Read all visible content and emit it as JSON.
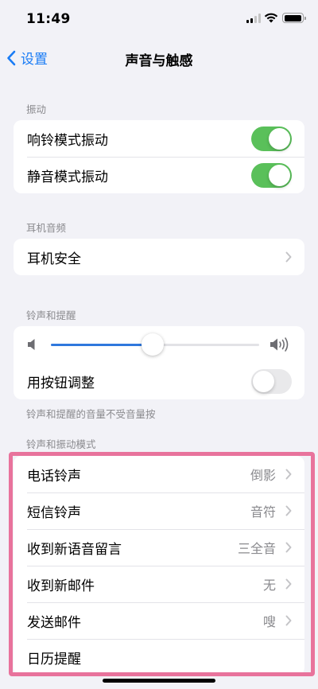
{
  "status_bar": {
    "time": "11:49"
  },
  "nav": {
    "back_label": "设置",
    "title": "声音与触感"
  },
  "vibration": {
    "header": "振动",
    "rows": [
      {
        "label": "响铃模式振动",
        "on": true
      },
      {
        "label": "静音模式振动",
        "on": true
      }
    ]
  },
  "headphone": {
    "header": "耳机音频",
    "rows": [
      {
        "label": "耳机安全"
      }
    ]
  },
  "ringer": {
    "header": "铃声和提醒",
    "volume_fraction": 0.49,
    "adjust_label": "用按钮调整",
    "adjust_on": false,
    "footer": "铃声和提醒的音量不受音量按"
  },
  "patterns": {
    "header": "铃声和振动模式",
    "rows": [
      {
        "label": "电话铃声",
        "value": "倒影"
      },
      {
        "label": "短信铃声",
        "value": "音符"
      },
      {
        "label": "收到新语音留言",
        "value": "三全音"
      },
      {
        "label": "收到新邮件",
        "value": "无"
      },
      {
        "label": "发送邮件",
        "value": "嗖"
      },
      {
        "label": "日历提醒",
        "value": ""
      }
    ]
  },
  "colors": {
    "accent": "#1a7cf5",
    "toggle_on": "#5ac05a",
    "highlight": "#e8739c"
  }
}
